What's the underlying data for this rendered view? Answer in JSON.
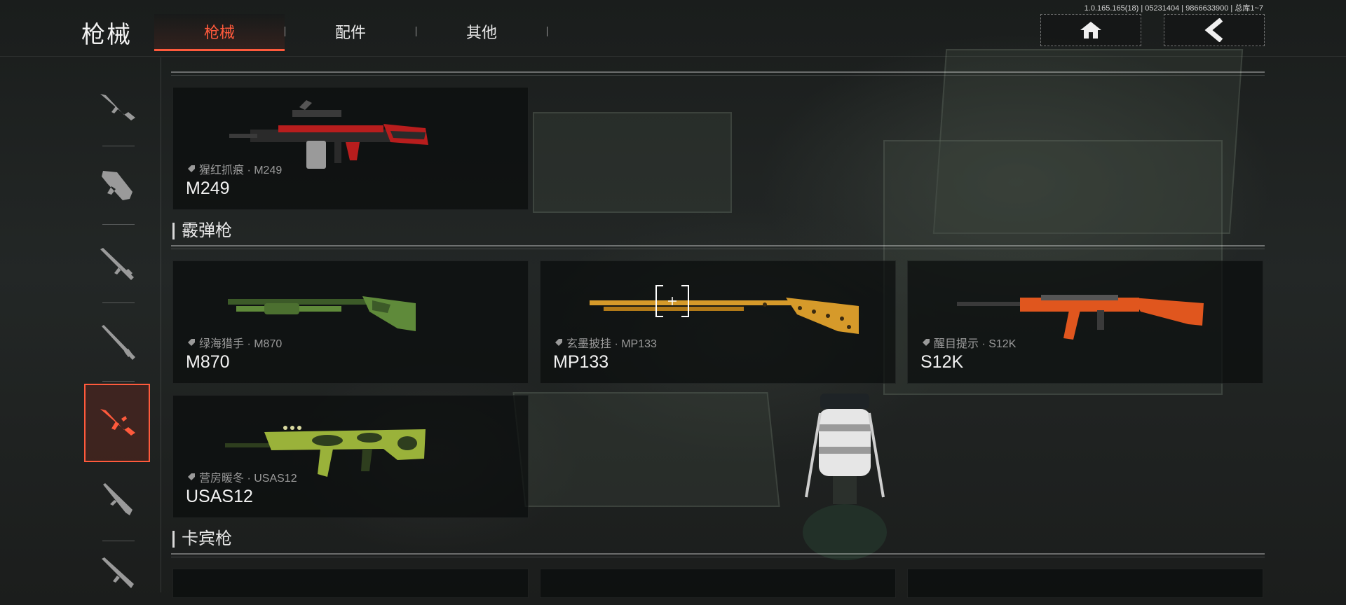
{
  "header": {
    "title": "枪械",
    "tabs": [
      {
        "label": "枪械",
        "active": true
      },
      {
        "label": "配件",
        "active": false
      },
      {
        "label": "其他",
        "active": false
      }
    ],
    "version_info": "1.0.165.165(18) | 05231404 | 9866633900 | 总库1~7",
    "home_icon": "home-icon",
    "back_icon": "chevron-left-icon"
  },
  "sidebar": {
    "items": [
      {
        "icon": "assault-rifle-icon",
        "active": false
      },
      {
        "icon": "smg-icon",
        "active": false
      },
      {
        "icon": "sniper-rifle-icon",
        "active": false
      },
      {
        "icon": "marksman-rifle-icon",
        "active": false
      },
      {
        "icon": "shotgun-icon",
        "active": true
      },
      {
        "icon": "carbine-icon",
        "active": false
      },
      {
        "icon": "pistol-icon",
        "active": false
      }
    ]
  },
  "sections": [
    {
      "title": "",
      "cards": [
        {
          "skin": "猩红抓痕 · M249",
          "name": "M249",
          "colors": [
            "#b81d1d",
            "#2a2a2a"
          ]
        }
      ]
    },
    {
      "title": "霰弹枪",
      "cards": [
        {
          "skin": "绿海猎手 · M870",
          "name": "M870",
          "colors": [
            "#5f8a3a",
            "#3c5a28"
          ]
        },
        {
          "skin": "玄墨披挂 · MP133",
          "name": "MP133",
          "colors": [
            "#d69a2a",
            "#5a3a10"
          ]
        },
        {
          "skin": "醒目提示 · S12K",
          "name": "S12K",
          "colors": [
            "#e0561e",
            "#3a3a3a"
          ]
        },
        {
          "skin": "营房暖冬 · USAS12",
          "name": "USAS12",
          "colors": [
            "#9ab23a",
            "#2e3e1e"
          ]
        }
      ]
    },
    {
      "title": "卡宾枪",
      "cards": []
    }
  ],
  "accent_color": "#ff5a3c"
}
